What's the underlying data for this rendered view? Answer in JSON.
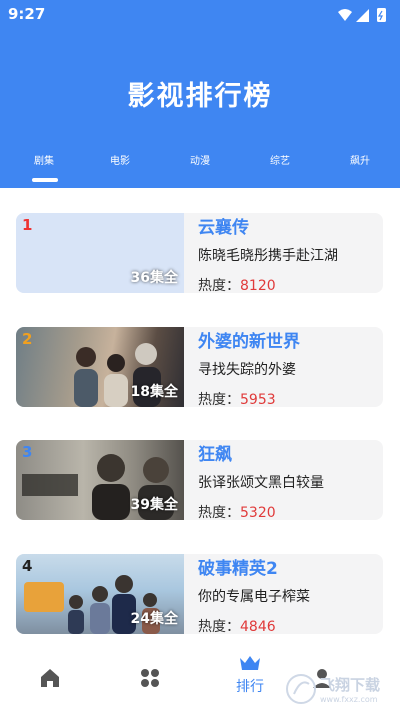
{
  "status": {
    "time": "9:27"
  },
  "header": {
    "title": "影视排行榜",
    "tabs": [
      "剧集",
      "电影",
      "动漫",
      "综艺",
      "飙升"
    ]
  },
  "list": {
    "heat_label": "热度：",
    "items": [
      {
        "rank": "1",
        "rank_color": "#e33",
        "title": "云襄传",
        "desc": "陈晓毛晓彤携手赴江湖",
        "heat": "8120",
        "episodes": "36集全"
      },
      {
        "rank": "2",
        "rank_color": "#f0a020",
        "title": "外婆的新世界",
        "desc": "寻找失踪的外婆",
        "heat": "5953",
        "episodes": "18集全"
      },
      {
        "rank": "3",
        "rank_color": "#3f86f2",
        "title": "狂飙",
        "desc": "张译张颂文黑白较量",
        "heat": "5320",
        "episodes": "39集全"
      },
      {
        "rank": "4",
        "rank_color": "#222",
        "title": "破事精英2",
        "desc": "你的专属电子榨菜",
        "heat": "4846",
        "episodes": "24集全"
      }
    ]
  },
  "bottom_nav": {
    "items": [
      {
        "icon": "home-icon",
        "label": ""
      },
      {
        "icon": "grid-icon",
        "label": ""
      },
      {
        "icon": "ranking-icon",
        "label": "排行"
      },
      {
        "icon": "profile-icon",
        "label": ""
      }
    ]
  },
  "colors": {
    "accent": "#3f86f2",
    "heat": "#e03a3a"
  },
  "watermark": {
    "text": "飞翔下载",
    "subtext": "www.fxxz.com"
  }
}
